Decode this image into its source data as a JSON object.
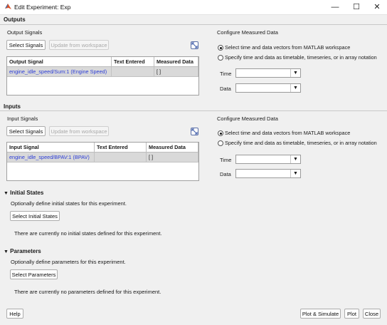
{
  "window": {
    "title": "Edit Experiment: Exp",
    "minimize_icon": "minimize-icon",
    "maximize_icon": "maximize-icon",
    "close_icon": "close-icon"
  },
  "outputs": {
    "section_title": "Outputs",
    "signals_title": "Output Signals",
    "select_button": "Select Signals",
    "update_button": "Update from workspace",
    "table": {
      "headers": [
        "Output Signal",
        "Text Entered",
        "Measured Data"
      ],
      "rows": [
        [
          "engine_idle_speed/Sum:1 (Engine Speed)",
          "",
          "[ ]"
        ]
      ]
    },
    "configure_title": "Configure Measured Data",
    "radio_option_1": "Select time and data vectors from MATLAB workspace",
    "radio_option_2": "Specify time and data as timetable, timeseries, or in array notation",
    "selected_option": 1,
    "time_label": "Time",
    "data_label": "Data",
    "time_value": "",
    "data_value": ""
  },
  "inputs": {
    "section_title": "Inputs",
    "signals_title": "Input Signals",
    "select_button": "Select Signals",
    "update_button": "Update from workspace",
    "table": {
      "headers": [
        "Input Signal",
        "Text Entered",
        "Measured Data"
      ],
      "rows": [
        [
          "engine_idle_speed/BPAV:1 (BPAV)",
          "",
          "[ ]"
        ]
      ]
    },
    "configure_title": "Configure Measured Data",
    "radio_option_1": "Select time and data vectors from MATLAB workspace",
    "radio_option_2": "Specify time and data as timetable, timeseries, or in array notation",
    "selected_option": 1,
    "time_label": "Time",
    "data_label": "Data",
    "time_value": "",
    "data_value": ""
  },
  "initial_states": {
    "title": "Initial States",
    "description": "Optionally define initial states for this experiment.",
    "button": "Select Initial States",
    "status": "There are currently no initial states defined for this experiment."
  },
  "parameters": {
    "title": "Parameters",
    "description": "Optionally define parameters for this experiment.",
    "button": "Select Parameters",
    "status": "There are currently no parameters defined for this experiment."
  },
  "footer": {
    "help": "Help",
    "plot_simulate": "Plot & Simulate",
    "plot": "Plot",
    "close": "Close"
  },
  "colors": {
    "link": "#2c3dd8",
    "row_fill": "#d9d9d9",
    "background": "#f0f0f0"
  }
}
